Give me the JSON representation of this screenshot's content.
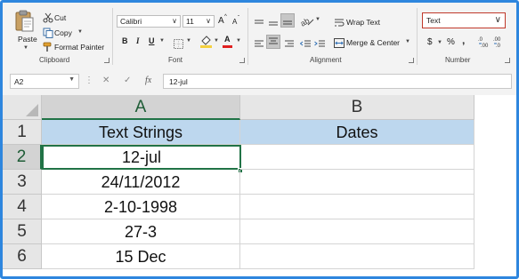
{
  "ribbon": {
    "clipboard": {
      "paste_label": "Paste",
      "cut_label": "Cut",
      "copy_label": "Copy",
      "format_painter_label": "Format Painter",
      "group_label": "Clipboard"
    },
    "font": {
      "font_name": "Calibri",
      "font_size": "11",
      "grow_label": "A",
      "shrink_label": "A",
      "bold_label": "B",
      "italic_label": "I",
      "underline_label": "U",
      "font_color_label": "A",
      "group_label": "Font"
    },
    "alignment": {
      "wrap_text_label": "Wrap Text",
      "merge_center_label": "Merge & Center",
      "group_label": "Alignment"
    },
    "number": {
      "format_value": "Text",
      "currency_label": "$",
      "percent_label": "%",
      "comma_label": "‚",
      "group_label": "Number"
    }
  },
  "formula_bar": {
    "name_box": "A2",
    "fx_label": "fx",
    "content": "12-jul"
  },
  "sheet": {
    "columns": [
      "A",
      "B"
    ],
    "rows": [
      "1",
      "2",
      "3",
      "4",
      "5",
      "6"
    ],
    "header_row": {
      "a": "Text Strings",
      "b": "Dates"
    },
    "values": [
      "12-jul",
      "24/11/2012",
      "2-10-1998",
      "27-3",
      "15 Dec"
    ],
    "active_cell": "A2"
  },
  "colors": {
    "frame_border": "#2e86de",
    "header_fill": "#bdd7ee",
    "selection_green": "#217346",
    "number_box_border": "#c0392b"
  }
}
